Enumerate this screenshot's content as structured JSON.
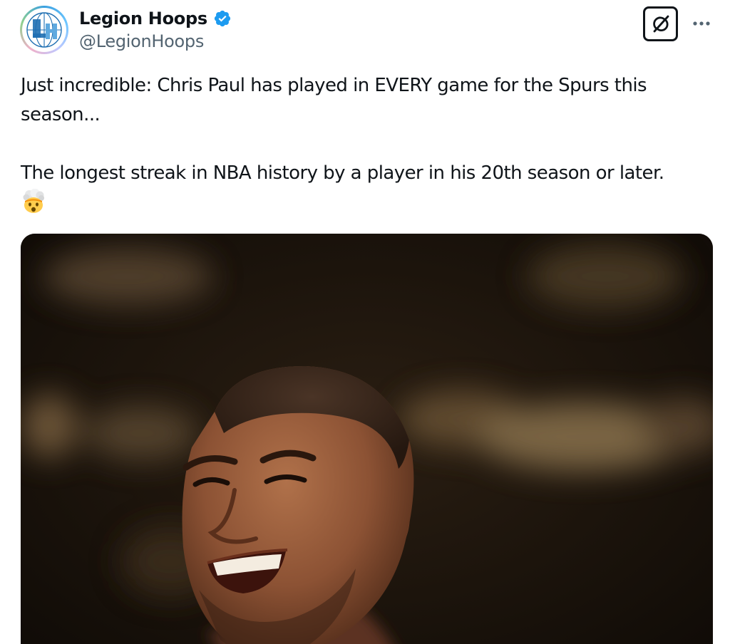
{
  "author": {
    "display_name": "Legion Hoops",
    "handle": "@LegionHoops",
    "verified": true,
    "avatar_icon": "legion-hoops-logo",
    "avatar_logo_text": "LH"
  },
  "actions": {
    "grok_icon": "grok-icon",
    "more_icon": "more-dots-icon"
  },
  "tweet": {
    "paragraph_1": "Just incredible: Chris Paul has played in EVERY game for the Spurs this season...",
    "paragraph_2": "The longest streak in NBA history by a player in his 20th season or later.",
    "emoji": "exploding-head-emoji"
  },
  "media": {
    "type": "photo",
    "subject": "player-portrait"
  },
  "colors": {
    "verified_blue": "#1d9bf0",
    "handle_gray": "#536471",
    "text": "#0f1419"
  }
}
